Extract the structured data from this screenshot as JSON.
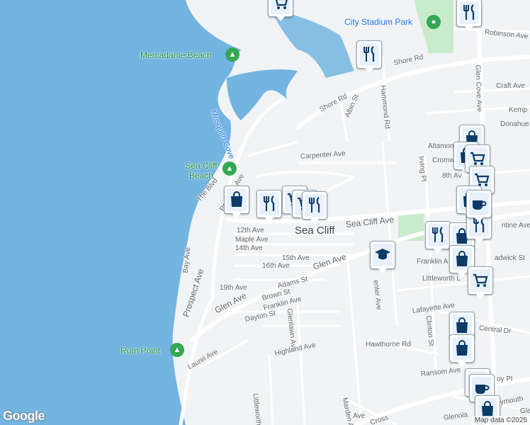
{
  "map": {
    "town_label": "Sea Cliff",
    "water_label": "Mosquito Cove",
    "attribution": "Map data ©2025",
    "logo": "Google",
    "colors": {
      "water": "#73b4e0",
      "land": "#f1f3f4",
      "park": "#c8ebcb",
      "road": "#ffffff",
      "marker_icon": "#0d3b66"
    }
  },
  "pois": [
    {
      "name": "City Stadium Park",
      "icon": "park-pin"
    },
    {
      "name": "Mercadante Beach",
      "icon": "park-pin"
    },
    {
      "name": "Sea Cliff Beach",
      "icon": "park-pin"
    },
    {
      "name": "Rum Point",
      "icon": "park-pin"
    }
  ],
  "streets": [
    "Shore Rd",
    "Robinson Ave",
    "Glen Cove Ave",
    "Craft Ave",
    "Kemp",
    "Donahue",
    "Shore Rd",
    "Albin St",
    "Hammond Rd",
    "Carpenter Ave",
    "Altamont",
    "Cromw",
    "8th Av",
    "Irving Pl",
    "The Blvd",
    "Prospect Ave",
    "12th Ave",
    "Maple Ave",
    "14th Ave",
    "15th Ave",
    "16th Ave",
    "Sea Cliff Ave",
    "Glen Ave",
    "Franklin A",
    "Littleworth L",
    "adwick St",
    "ntine Ave",
    "Bay Ave",
    "19th Ave",
    "Adams St",
    "Brown St",
    "Franklin Ave",
    "Dayton St",
    "Glen Ave",
    "Glenlawn Ave",
    "Lafayette Ave",
    "Central Dr",
    "Clinton St",
    "Hawthorne Rd",
    "Highland Ave",
    "Laurel Ave",
    "Littleworth Ln",
    "Marden Ave",
    "Ransom Ave",
    "Glenola",
    "Prospect Ave",
    "enter Ave",
    "Cross",
    "Ave",
    "oy Pl",
    "ymouth",
    "Glen"
  ],
  "markers": [
    "shopping-cart-icon",
    "restaurant-icon",
    "restaurant-icon",
    "shopping-bag-icon",
    "restaurant-icon",
    "shopping-cart-icon",
    "shopping-cart-icon",
    "restaurant-icon",
    "school-icon",
    "restaurant-icon",
    "shopping-bag-icon",
    "restaurant-icon",
    "shopping-bag-icon",
    "shopping-bag-icon",
    "shopping-cart-icon",
    "shopping-cart-icon",
    "shopping-bag-icon",
    "coffee-icon",
    "shopping-bag-icon",
    "shopping-cart-icon",
    "shopping-bag-icon",
    "shopping-bag-icon",
    "shopping-bag-icon",
    "coffee-icon",
    "shopping-bag-icon"
  ]
}
